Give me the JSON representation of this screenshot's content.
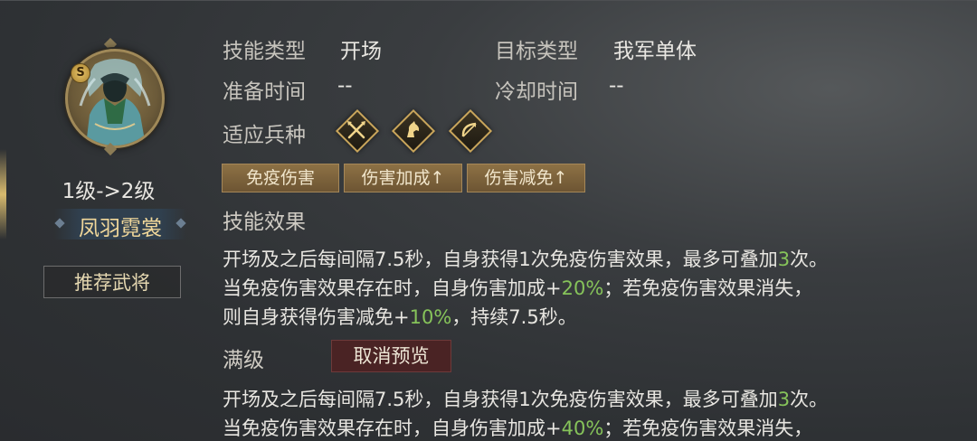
{
  "hero": {
    "grade": "S",
    "level_text": "1级->2级",
    "name": "凤羽霓裳",
    "recommend_label": "推荐武将"
  },
  "skill_info": {
    "type_label": "技能类型",
    "type_value": "开场",
    "target_label": "目标类型",
    "target_value": "我军单体",
    "prep_label": "准备时间",
    "prep_value": "--",
    "cooldown_label": "冷却时间",
    "cooldown_value": "--",
    "troop_label": "适应兵种",
    "troops": [
      "spear-troop-icon",
      "cavalry-troop-icon",
      "archer-troop-icon"
    ]
  },
  "tags": [
    "免疫伤害",
    "伤害加成↑",
    "伤害减免↑"
  ],
  "effect": {
    "title": "技能效果",
    "line1_a": "开场及之后每间隔7.5秒，自身获得1次免疫伤害效果，最多可叠加",
    "line1_g": "3",
    "line1_b": "次。",
    "line2_a": "当免疫伤害效果存在时，自身伤害加成+",
    "line2_g": "20%",
    "line2_b": "；若免疫伤害效果消失，",
    "line3_a": "则自身获得伤害减免+",
    "line3_g": "10%",
    "line3_b": "，持续7.5秒。"
  },
  "max_level": {
    "title": "满级",
    "cancel_preview_label": "取消预览",
    "line1_a": "开场及之后每间隔7.5秒，自身获得1次免疫伤害效果，最多可叠加",
    "line1_g": "3",
    "line1_b": "次。",
    "line2_a": "当免疫伤害效果存在时，自身伤害加成+",
    "line2_g": "40%",
    "line2_b": "；若免疫伤害效果消失，"
  },
  "colors": {
    "highlight_green": "#86c35a",
    "tag_gold": "#8d7145",
    "cancel_red": "#4a2324"
  }
}
